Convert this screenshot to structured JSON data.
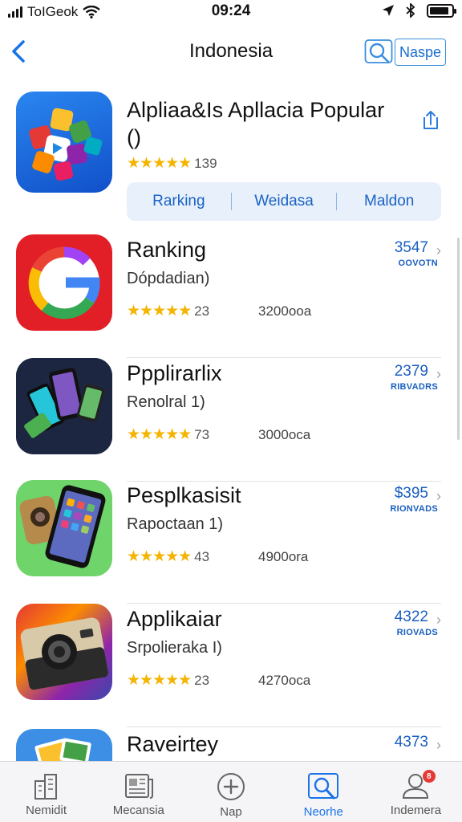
{
  "status_bar": {
    "carrier": "ToIGeok",
    "time": "09:24",
    "battery_level": 0.9
  },
  "nav": {
    "title": "Indonesia",
    "action_label": "Naspe"
  },
  "featured": {
    "title": "Alpliaa&Is Apllacia Popular ()",
    "rating_stars": "★★★★★",
    "rating_value": 4.5,
    "rating_count": "139",
    "segments": [
      "Rarking",
      "Weidasa",
      "Maldon"
    ]
  },
  "apps": [
    {
      "name": "Ranking",
      "subtitle": "Dópdadian)",
      "stars": "★★★★★",
      "rating_value": 4.5,
      "rating_count": "23",
      "downloads": "3200ooa",
      "price": "3547",
      "meta": "OOVOTN"
    },
    {
      "name": "Ppplirarlix",
      "subtitle": "Renolral 1)",
      "stars": "★★★★★",
      "rating_value": 4.5,
      "rating_count": "73",
      "downloads": "3000oca",
      "price": "2379",
      "meta": "RIBVADRS"
    },
    {
      "name": "Pesplkasisit",
      "subtitle": "Rapoctaan 1)",
      "stars": "★★★★★",
      "rating_value": 4.5,
      "rating_count": "43",
      "downloads": "4900ora",
      "price": "$395",
      "meta": "RIONVADS"
    },
    {
      "name": "Applikaiar",
      "subtitle": "Srpolieraka I)",
      "stars": "★★★★★",
      "rating_value": 4.5,
      "rating_count": "23",
      "downloads": "4270oca",
      "price": "4322",
      "meta": "RIOVADS"
    },
    {
      "name": "Raveirtey",
      "subtitle": "",
      "stars": "",
      "rating_value": null,
      "rating_count": "",
      "downloads": "",
      "price": "4373",
      "meta": ""
    }
  ],
  "tabs": [
    {
      "label": "Nemidit",
      "icon": "buildings-icon",
      "active": false
    },
    {
      "label": "Mecansia",
      "icon": "newspaper-icon",
      "active": false
    },
    {
      "label": "Nap",
      "icon": "plus-circle-icon",
      "active": false
    },
    {
      "label": "Neorhe",
      "icon": "search-icon",
      "active": true
    },
    {
      "label": "Indemera",
      "icon": "person-icon",
      "active": false,
      "badge": "8"
    }
  ],
  "colors": {
    "accent": "#1a73e8",
    "star": "#f4b400",
    "badge": "#e53935"
  }
}
